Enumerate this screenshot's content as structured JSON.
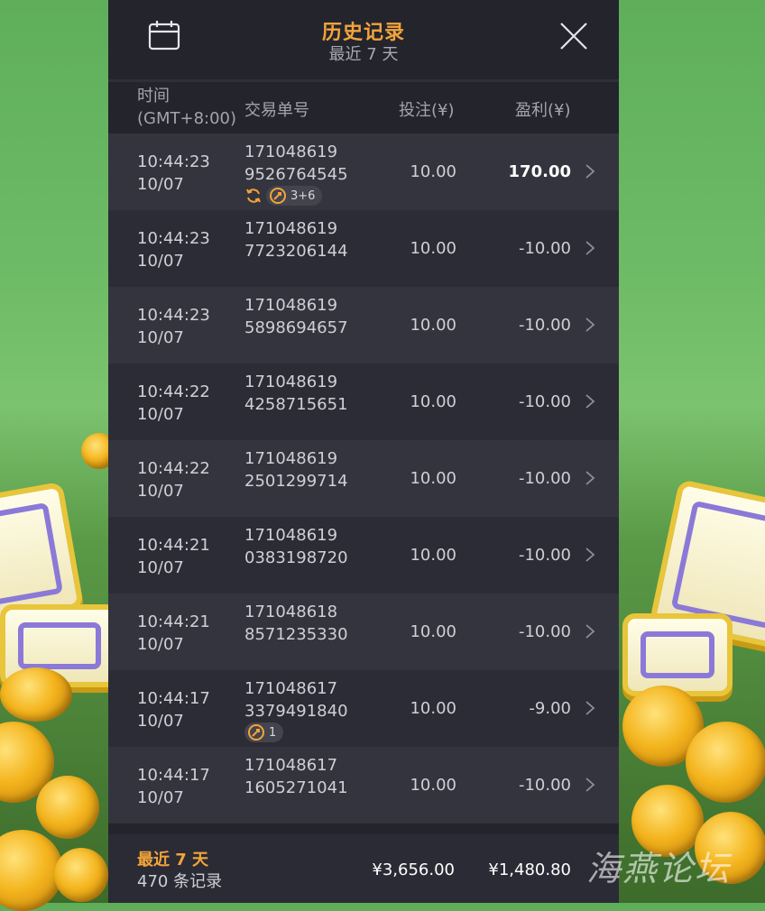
{
  "header": {
    "title": "历史记录",
    "subtitle": "最近 7 天"
  },
  "columns": {
    "time_line1": "时间",
    "time_line2": "(GMT+8:00)",
    "transaction_id": "交易单号",
    "bet": "投注(¥)",
    "profit": "盈利(¥)"
  },
  "rows": [
    {
      "time": "10:44:23",
      "date": "10/07",
      "id1": "171048619",
      "id2": "9526764545",
      "bet": "10.00",
      "profit": "170.00",
      "positive": true,
      "badges": {
        "respin": true,
        "pill_text": "3+6"
      }
    },
    {
      "time": "10:44:23",
      "date": "10/07",
      "id1": "171048619",
      "id2": "7723206144",
      "bet": "10.00",
      "profit": "-10.00"
    },
    {
      "time": "10:44:23",
      "date": "10/07",
      "id1": "171048619",
      "id2": "5898694657",
      "bet": "10.00",
      "profit": "-10.00"
    },
    {
      "time": "10:44:22",
      "date": "10/07",
      "id1": "171048619",
      "id2": "4258715651",
      "bet": "10.00",
      "profit": "-10.00"
    },
    {
      "time": "10:44:22",
      "date": "10/07",
      "id1": "171048619",
      "id2": "2501299714",
      "bet": "10.00",
      "profit": "-10.00"
    },
    {
      "time": "10:44:21",
      "date": "10/07",
      "id1": "171048619",
      "id2": "0383198720",
      "bet": "10.00",
      "profit": "-10.00"
    },
    {
      "time": "10:44:21",
      "date": "10/07",
      "id1": "171048618",
      "id2": "8571235330",
      "bet": "10.00",
      "profit": "-10.00"
    },
    {
      "time": "10:44:17",
      "date": "10/07",
      "id1": "171048617",
      "id2": "3379491840",
      "bet": "10.00",
      "profit": "-9.00",
      "badges": {
        "respin": false,
        "pill_text": "1"
      }
    },
    {
      "time": "10:44:17",
      "date": "10/07",
      "id1": "171048617",
      "id2": "1605271041",
      "bet": "10.00",
      "profit": "-10.00"
    }
  ],
  "footer": {
    "range": "最近 7 天",
    "count": "470 条记录",
    "total_bet": "¥3,656.00",
    "total_profit": "¥1,480.80"
  },
  "watermark": "海燕论坛",
  "colors": {
    "accent": "#f2a43a",
    "panel_bg": "#24242d",
    "row_odd": "#34343e",
    "row_even": "#2c2c36"
  },
  "icons": {
    "calendar": "calendar-icon",
    "close": "close-icon",
    "row_arrow": "chevron-right-icon",
    "respin": "refresh-icon",
    "free_spin": "free-spin-icon"
  }
}
